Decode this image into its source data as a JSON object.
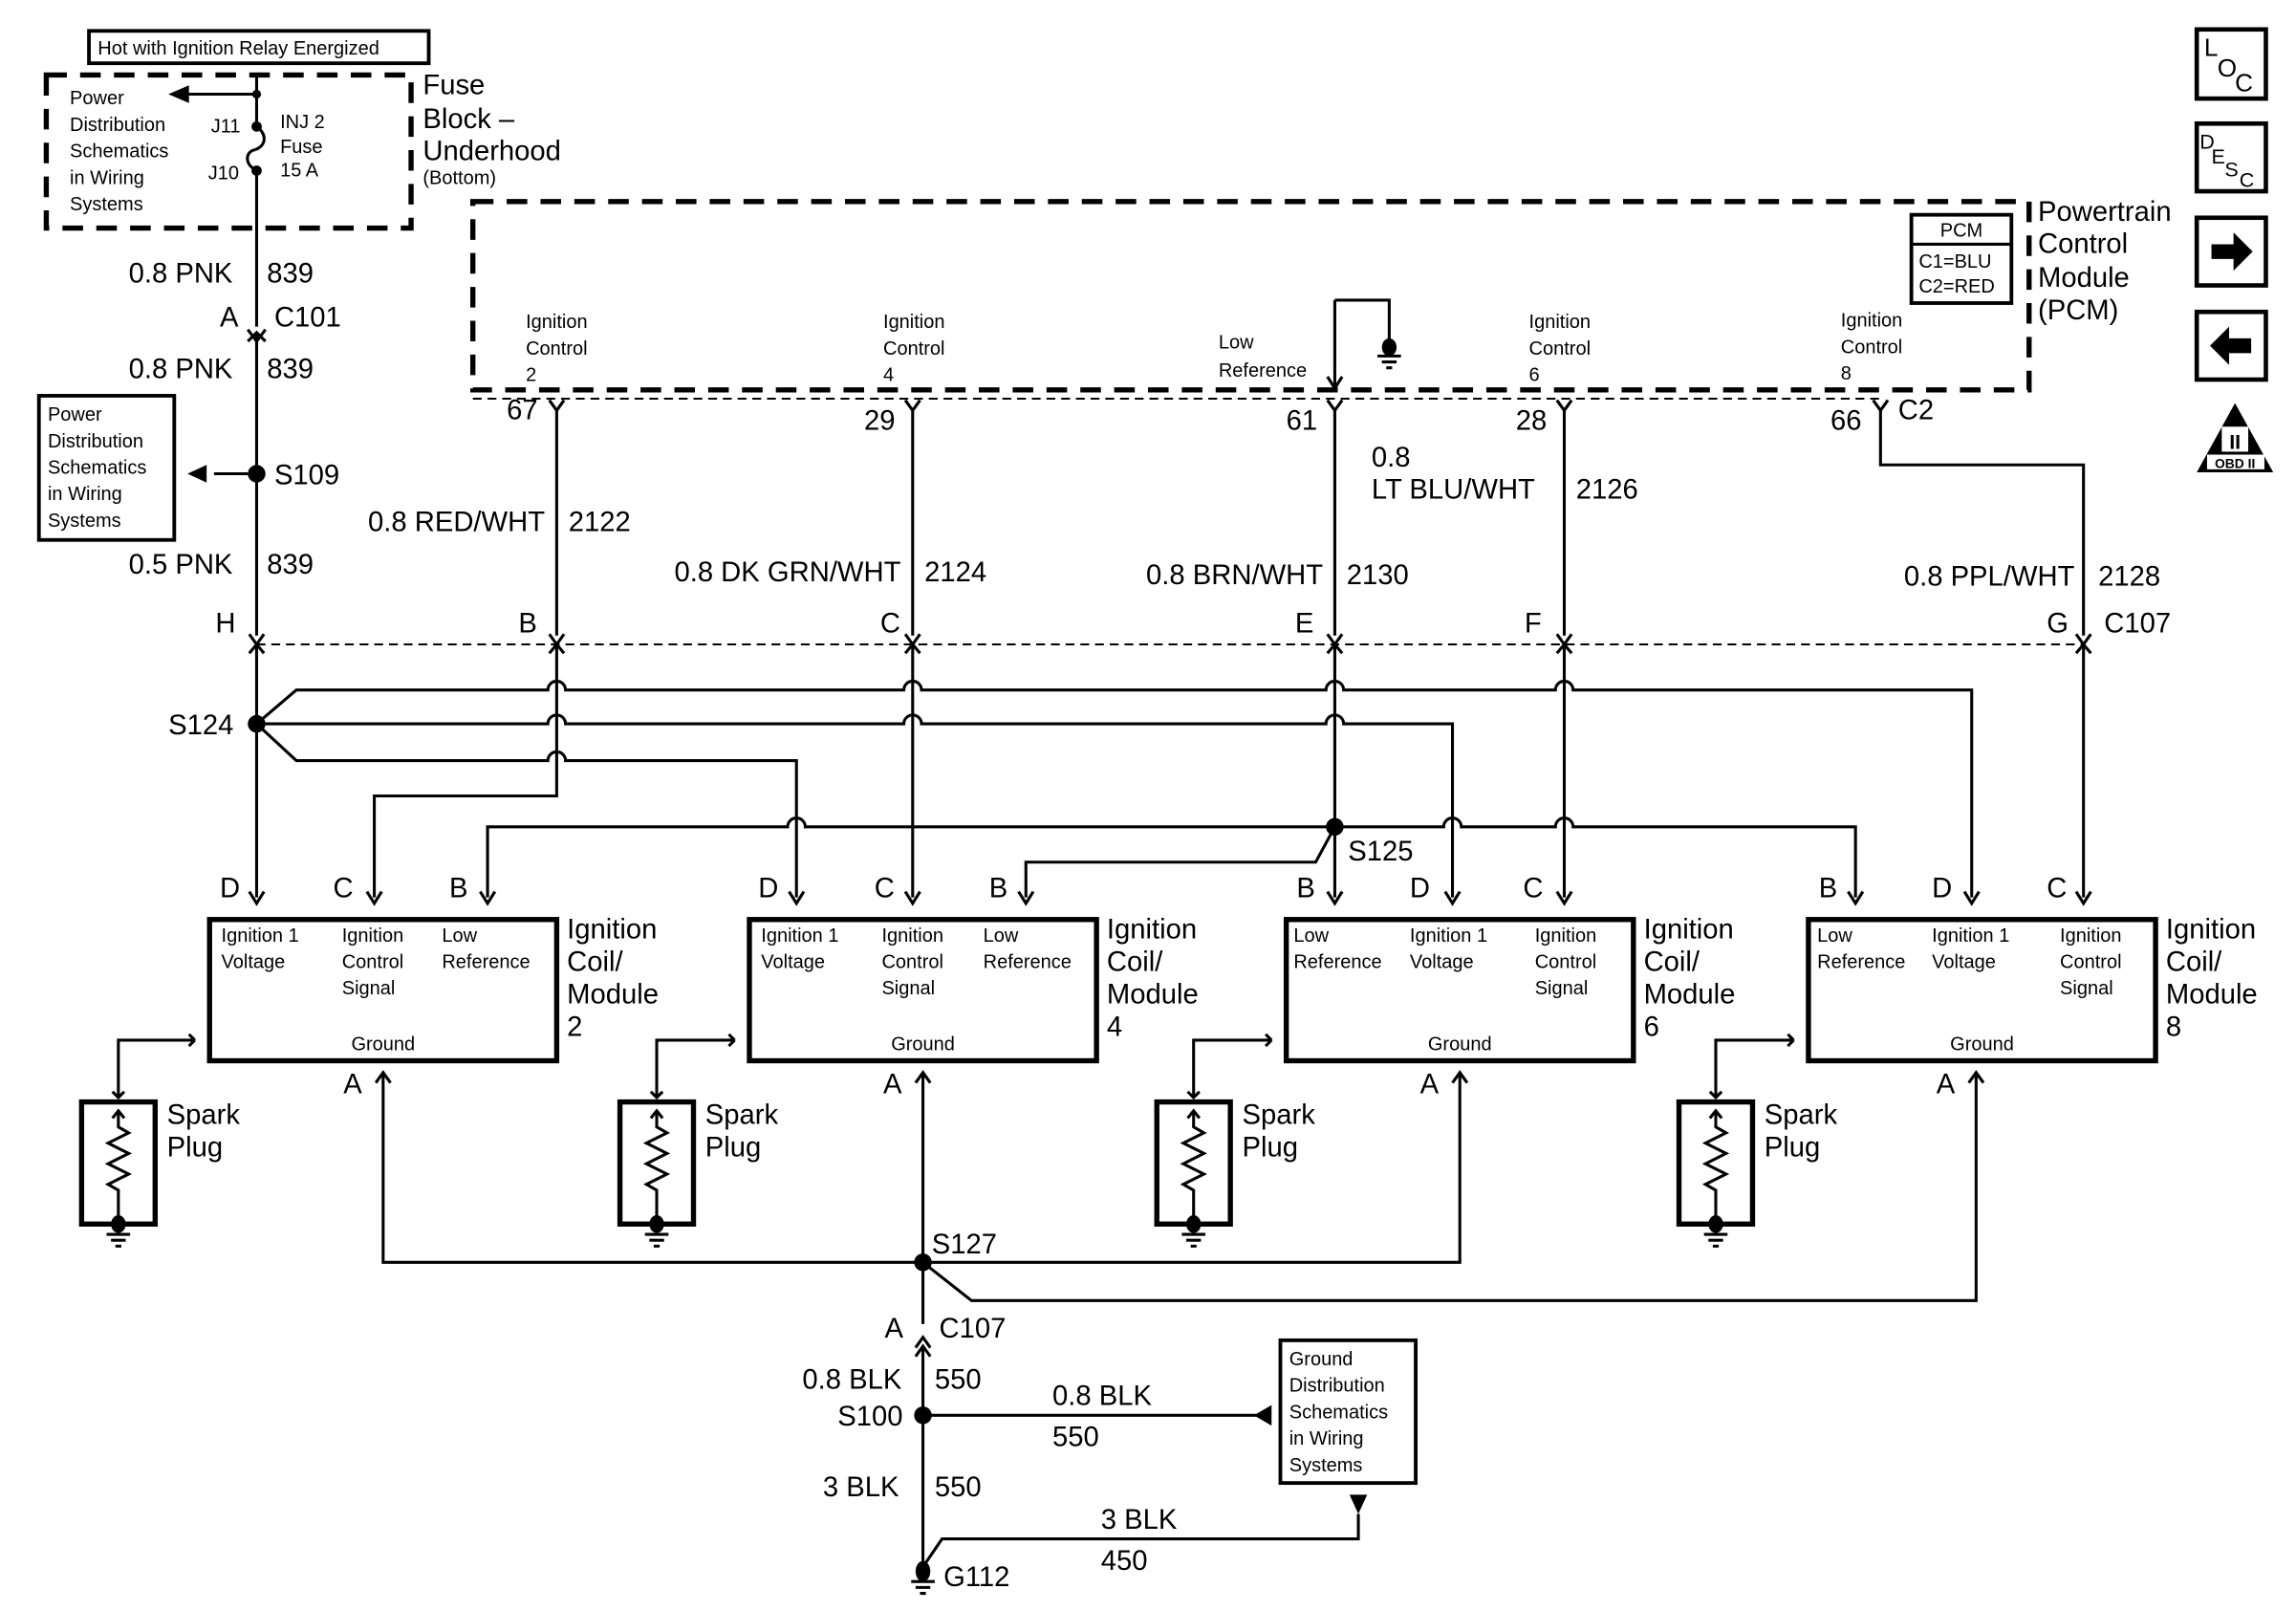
{
  "header": {
    "hot_label": "Hot with Ignition Relay Energized"
  },
  "fuse_block": {
    "title_lines": [
      "Fuse",
      "Block –",
      "Underhood"
    ],
    "subtitle": "(Bottom)",
    "power_dist_lines": [
      "Power",
      "Distribution",
      "Schematics",
      "in Wiring",
      "Systems"
    ],
    "j11": "J11",
    "j10": "J10",
    "fuse_lines": [
      "INJ 2",
      "Fuse",
      "15 A"
    ]
  },
  "feed": {
    "wire1_color": "0.8 PNK",
    "wire1_circuit": "839",
    "c101_pin": "A",
    "c101": "C101",
    "wire2_color": "0.8 PNK",
    "wire2_circuit": "839",
    "s109": "S109",
    "power_dist_lines": [
      "Power",
      "Distribution",
      "Schematics",
      "in Wiring",
      "Systems"
    ],
    "wire3_color": "0.5 PNK",
    "wire3_circuit": "839",
    "c107_pin_h": "H",
    "s124": "S124"
  },
  "pcm": {
    "title_lines": [
      "Powertrain",
      "Control",
      "Module",
      "(PCM)"
    ],
    "legend_title": "PCM",
    "legend_lines": [
      "C1=BLU",
      "C2=RED"
    ],
    "connector": "C2",
    "terminals": [
      {
        "label_lines": [
          "Ignition",
          "Control",
          "2"
        ],
        "pin": "67",
        "wire_color": "0.8 RED/WHT",
        "circuit": "2122",
        "c107_pin": "B"
      },
      {
        "label_lines": [
          "Ignition",
          "Control",
          "4"
        ],
        "pin": "29",
        "wire_color": "0.8 DK GRN/WHT",
        "circuit": "2124",
        "c107_pin": "C"
      },
      {
        "label_lines": [
          "Low",
          "Reference"
        ],
        "pin": "61",
        "wire_color": "0.8 BRN/WHT",
        "circuit": "2130",
        "c107_pin": "E"
      },
      {
        "label_lines": [
          "Ignition",
          "Control",
          "6"
        ],
        "pin": "28",
        "wire_color_lines": [
          "0.8",
          "LT BLU/WHT"
        ],
        "circuit": "2126",
        "c107_pin": "F"
      },
      {
        "label_lines": [
          "Ignition",
          "Control",
          "8"
        ],
        "pin": "66",
        "wire_color": "0.8 PPL/WHT",
        "circuit": "2128",
        "c107_pin": "G"
      }
    ]
  },
  "c107": "C107",
  "s125": "S125",
  "coils": [
    {
      "name_lines": [
        "Ignition",
        "Coil/",
        "Module",
        "2"
      ],
      "pins": [
        {
          "letter": "D",
          "lines": [
            "Ignition 1",
            "Voltage"
          ]
        },
        {
          "letter": "C",
          "lines": [
            "Ignition",
            "Control",
            "Signal"
          ]
        },
        {
          "letter": "B",
          "lines": [
            "Low",
            "Reference"
          ]
        }
      ],
      "ground": "Ground",
      "ground_pin": "A",
      "spark_lines": [
        "Spark",
        "Plug"
      ]
    },
    {
      "name_lines": [
        "Ignition",
        "Coil/",
        "Module",
        "4"
      ],
      "pins": [
        {
          "letter": "D",
          "lines": [
            "Ignition 1",
            "Voltage"
          ]
        },
        {
          "letter": "C",
          "lines": [
            "Ignition",
            "Control",
            "Signal"
          ]
        },
        {
          "letter": "B",
          "lines": [
            "Low",
            "Reference"
          ]
        }
      ],
      "ground": "Ground",
      "ground_pin": "A",
      "spark_lines": [
        "Spark",
        "Plug"
      ]
    },
    {
      "name_lines": [
        "Ignition",
        "Coil/",
        "Module",
        "6"
      ],
      "pins": [
        {
          "letter": "B",
          "lines": [
            "Low",
            "Reference"
          ]
        },
        {
          "letter": "D",
          "lines": [
            "Ignition 1",
            "Voltage"
          ]
        },
        {
          "letter": "C",
          "lines": [
            "Ignition",
            "Control",
            "Signal"
          ]
        }
      ],
      "ground": "Ground",
      "ground_pin": "A",
      "spark_lines": [
        "Spark",
        "Plug"
      ]
    },
    {
      "name_lines": [
        "Ignition",
        "Coil/",
        "Module",
        "8"
      ],
      "pins": [
        {
          "letter": "B",
          "lines": [
            "Low",
            "Reference"
          ]
        },
        {
          "letter": "D",
          "lines": [
            "Ignition 1",
            "Voltage"
          ]
        },
        {
          "letter": "C",
          "lines": [
            "Ignition",
            "Control",
            "Signal"
          ]
        }
      ],
      "ground": "Ground",
      "ground_pin": "A",
      "spark_lines": [
        "Spark",
        "Plug"
      ]
    }
  ],
  "ground": {
    "s127": "S127",
    "c107_pin": "A",
    "c107": "C107",
    "wire1_color": "0.8 BLK",
    "wire1_circuit": "550",
    "s100": "S100",
    "branch_color": "0.8 BLK",
    "branch_circuit": "550",
    "wire2_color": "3 BLK",
    "wire2_circuit": "550",
    "g112_branch_color": "3 BLK",
    "g112_branch_circuit": "450",
    "g112": "G112",
    "ground_dist_lines": [
      "Ground",
      "Distribution",
      "Schematics",
      "in Wiring",
      "Systems"
    ]
  },
  "nav": {
    "loc": {
      "l": "L",
      "o": "O",
      "c": "C"
    },
    "desc": {
      "d": "D",
      "e": "E",
      "s": "S",
      "c": "C"
    },
    "obd": {
      "roman": "II",
      "label": "OBD II"
    }
  }
}
